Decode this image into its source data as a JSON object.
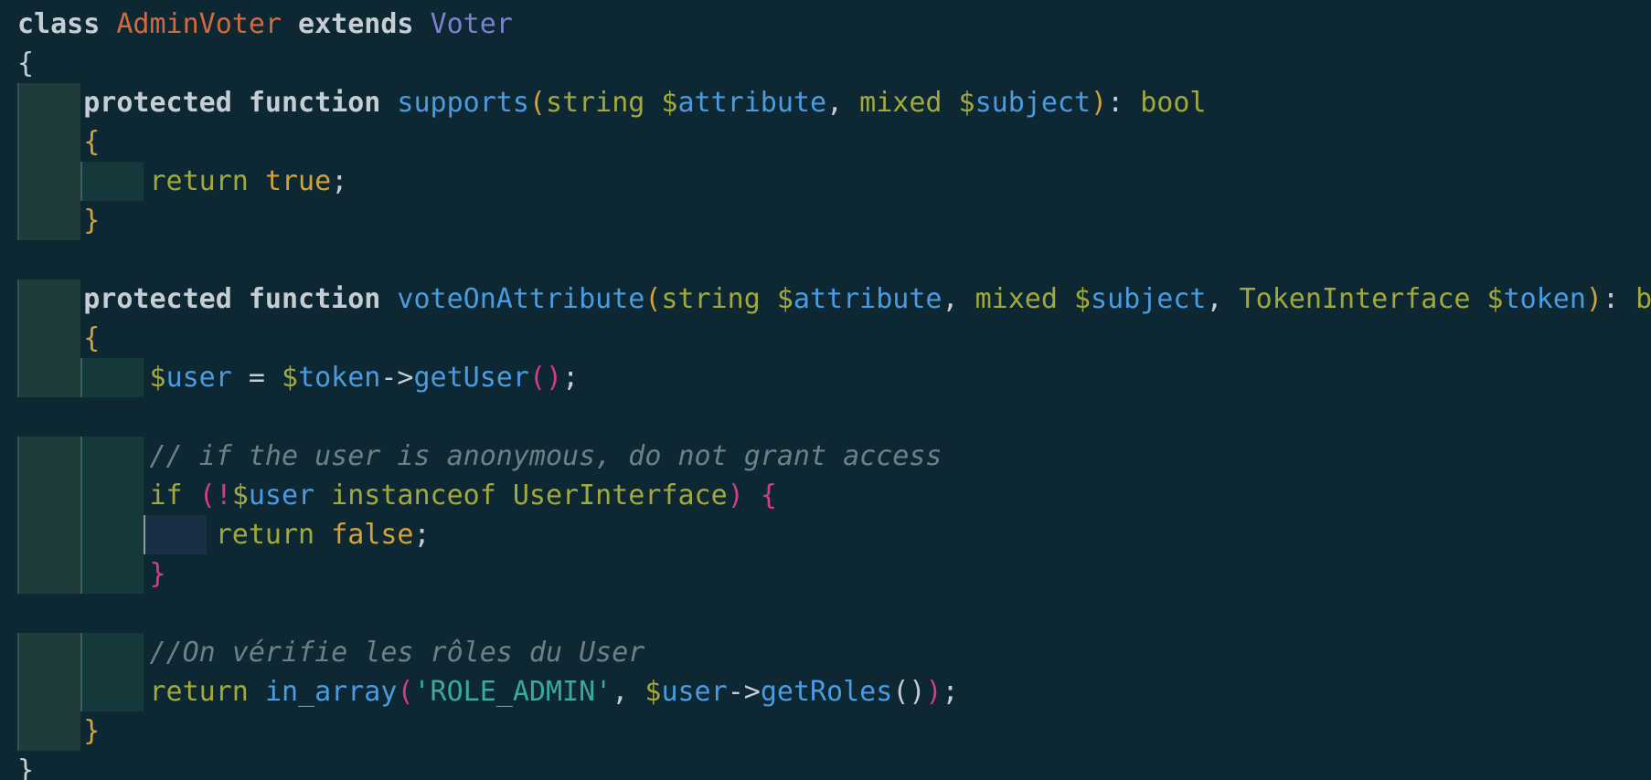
{
  "editor": {
    "lines": [
      [
        {
          "t": "class ",
          "c": "k"
        },
        {
          "t": "AdminVoter",
          "c": "cls"
        },
        {
          "t": " extends ",
          "c": "k"
        },
        {
          "t": "Voter",
          "c": "par"
        }
      ],
      [
        {
          "t": "{",
          "c": "def"
        }
      ],
      [
        {
          "t": "    ",
          "c": "def"
        },
        {
          "t": "protected function ",
          "c": "k"
        },
        {
          "t": "supports",
          "c": "fn"
        },
        {
          "t": "(",
          "c": "br1"
        },
        {
          "t": "string ",
          "c": "typ"
        },
        {
          "t": "$",
          "c": "dol"
        },
        {
          "t": "attribute",
          "c": "var"
        },
        {
          "t": ", ",
          "c": "pun"
        },
        {
          "t": "mixed ",
          "c": "typ"
        },
        {
          "t": "$",
          "c": "dol"
        },
        {
          "t": "subject",
          "c": "var"
        },
        {
          "t": ")",
          "c": "br1"
        },
        {
          "t": ": ",
          "c": "pun"
        },
        {
          "t": "bool",
          "c": "typ"
        }
      ],
      [
        {
          "t": "    ",
          "c": "def"
        },
        {
          "t": "{",
          "c": "br1"
        }
      ],
      [
        {
          "t": "        ",
          "c": "def"
        },
        {
          "t": "return ",
          "c": "typ"
        },
        {
          "t": "true",
          "c": "lit"
        },
        {
          "t": ";",
          "c": "pun"
        }
      ],
      [
        {
          "t": "    ",
          "c": "def"
        },
        {
          "t": "}",
          "c": "br1"
        }
      ],
      [],
      [
        {
          "t": "    ",
          "c": "def"
        },
        {
          "t": "protected function ",
          "c": "k"
        },
        {
          "t": "voteOnAttribute",
          "c": "fn"
        },
        {
          "t": "(",
          "c": "br1"
        },
        {
          "t": "string ",
          "c": "typ"
        },
        {
          "t": "$",
          "c": "dol"
        },
        {
          "t": "attribute",
          "c": "var"
        },
        {
          "t": ", ",
          "c": "pun"
        },
        {
          "t": "mixed ",
          "c": "typ"
        },
        {
          "t": "$",
          "c": "dol"
        },
        {
          "t": "subject",
          "c": "var"
        },
        {
          "t": ", ",
          "c": "pun"
        },
        {
          "t": "TokenInterface ",
          "c": "typ"
        },
        {
          "t": "$",
          "c": "dol"
        },
        {
          "t": "token",
          "c": "var"
        },
        {
          "t": ")",
          "c": "br1"
        },
        {
          "t": ": ",
          "c": "pun"
        },
        {
          "t": "bool",
          "c": "typ"
        }
      ],
      [
        {
          "t": "    ",
          "c": "def"
        },
        {
          "t": "{",
          "c": "br1"
        }
      ],
      [
        {
          "t": "        ",
          "c": "def"
        },
        {
          "t": "$",
          "c": "dol"
        },
        {
          "t": "user",
          "c": "var"
        },
        {
          "t": " = ",
          "c": "pun"
        },
        {
          "t": "$",
          "c": "dol"
        },
        {
          "t": "token",
          "c": "var"
        },
        {
          "t": "->",
          "c": "pun"
        },
        {
          "t": "getUser",
          "c": "fn"
        },
        {
          "t": "()",
          "c": "br2"
        },
        {
          "t": ";",
          "c": "pun"
        }
      ],
      [],
      [
        {
          "t": "        ",
          "c": "def"
        },
        {
          "t": "// if the user is anonymous, do not grant access",
          "c": "cmt"
        }
      ],
      [
        {
          "t": "        ",
          "c": "def"
        },
        {
          "t": "if ",
          "c": "typ"
        },
        {
          "t": "(",
          "c": "br2"
        },
        {
          "t": "!",
          "c": "br2"
        },
        {
          "t": "$",
          "c": "dol"
        },
        {
          "t": "user",
          "c": "var"
        },
        {
          "t": " instanceof ",
          "c": "typ"
        },
        {
          "t": "UserInterface",
          "c": "typ"
        },
        {
          "t": ")",
          "c": "br2"
        },
        {
          "t": " ",
          "c": "def"
        },
        {
          "t": "{",
          "c": "br2"
        }
      ],
      [
        {
          "t": "            ",
          "c": "def"
        },
        {
          "t": "return ",
          "c": "typ"
        },
        {
          "t": "false",
          "c": "lit"
        },
        {
          "t": ";",
          "c": "pun"
        }
      ],
      [
        {
          "t": "        ",
          "c": "def"
        },
        {
          "t": "}",
          "c": "br2"
        }
      ],
      [],
      [
        {
          "t": "        ",
          "c": "def"
        },
        {
          "t": "//On vérifie les rôles du User",
          "c": "cmt"
        }
      ],
      [
        {
          "t": "        ",
          "c": "def"
        },
        {
          "t": "return ",
          "c": "typ"
        },
        {
          "t": "in_array",
          "c": "fn"
        },
        {
          "t": "(",
          "c": "br2"
        },
        {
          "t": "'ROLE_ADMIN'",
          "c": "str"
        },
        {
          "t": ", ",
          "c": "pun"
        },
        {
          "t": "$",
          "c": "dol"
        },
        {
          "t": "user",
          "c": "var"
        },
        {
          "t": "->",
          "c": "pun"
        },
        {
          "t": "getRoles",
          "c": "fn"
        },
        {
          "t": "()",
          "c": "def"
        },
        {
          "t": ")",
          "c": "br2"
        },
        {
          "t": ";",
          "c": "pun"
        }
      ],
      [
        {
          "t": "    ",
          "c": "def"
        },
        {
          "t": "}",
          "c": "br1"
        }
      ],
      [
        {
          "t": "}",
          "c": "def"
        }
      ]
    ]
  }
}
